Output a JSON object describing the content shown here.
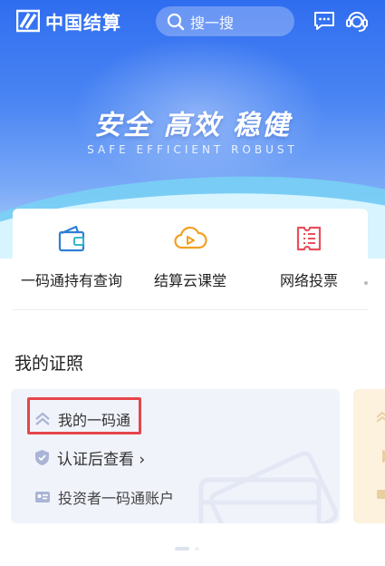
{
  "app": {
    "logo_text": "中国结算"
  },
  "search": {
    "placeholder": "搜一搜"
  },
  "banner": {
    "slogan": "安全 高效 稳健",
    "slogan_en": "SAFE EFFICIENT ROBUST"
  },
  "quick_actions": [
    {
      "label": "一码通持有查询",
      "icon": "wallet-icon"
    },
    {
      "label": "结算云课堂",
      "icon": "play-cloud-icon"
    },
    {
      "label": "网络投票",
      "icon": "ticket-icon"
    }
  ],
  "section": {
    "title": "我的证照"
  },
  "cert_card": {
    "title": "我的一码通",
    "verify_link": "认证后查看 ›",
    "account_label": "投资者一码通账户"
  },
  "colors": {
    "brand_blue": "#2f6df0",
    "highlight_red": "#e5464a",
    "wallet_blue": "#2f7fd6",
    "cloud_orange": "#f2a021",
    "ticket_red": "#e8505b"
  }
}
